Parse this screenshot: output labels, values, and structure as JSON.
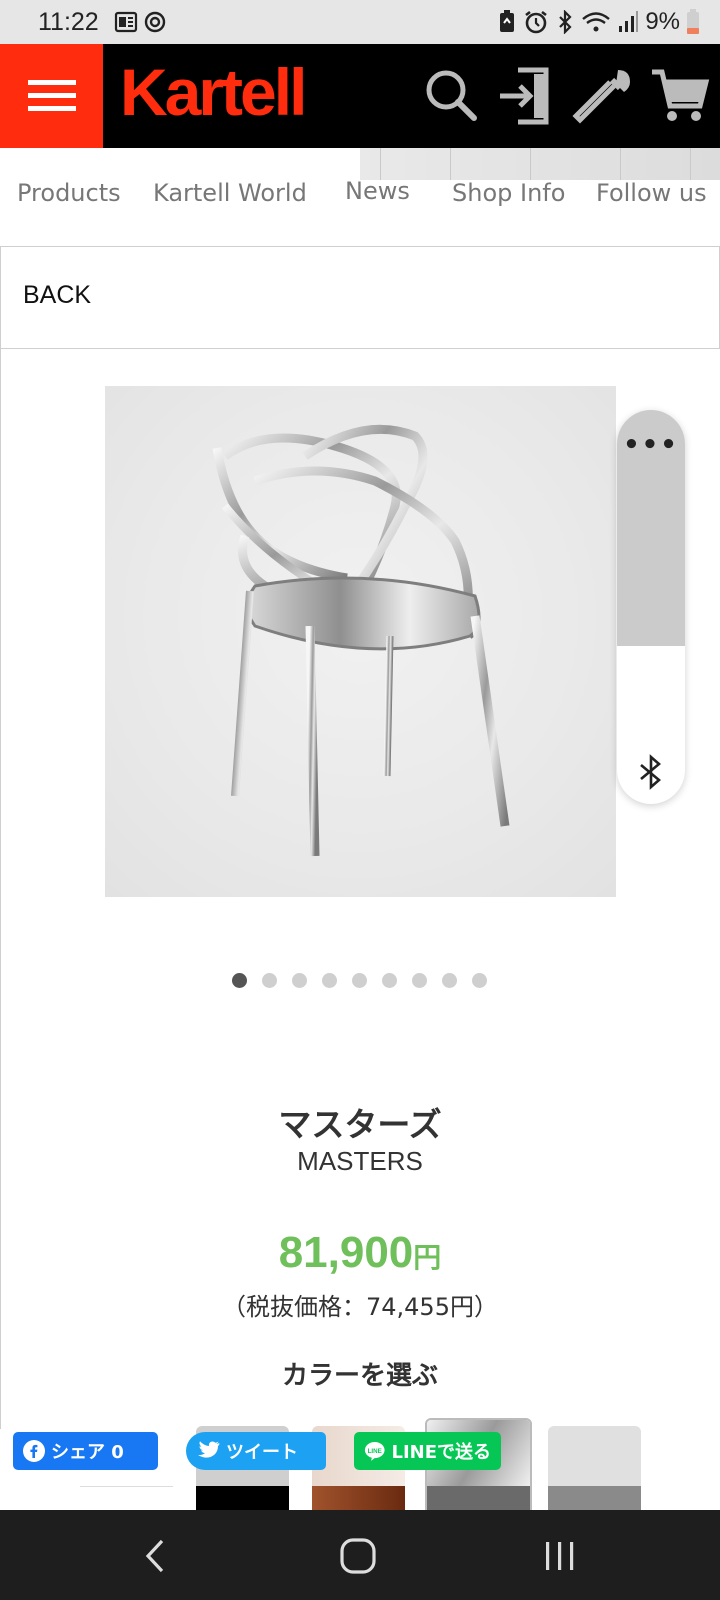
{
  "status_bar": {
    "time": "11:22",
    "battery": "9%",
    "icons": [
      "news-icon",
      "sync-icon",
      "battery-saver-icon",
      "alarm-icon",
      "bluetooth-icon",
      "wifi-icon",
      "signal-icon",
      "battery-icon"
    ]
  },
  "header": {
    "brand": "Kartell",
    "brand_color": "#ff2d0e",
    "icons": [
      "menu-icon",
      "search-icon",
      "login-icon",
      "eyedropper-icon",
      "cart-icon"
    ]
  },
  "nav": {
    "items": [
      "Products",
      "Kartell World",
      "News",
      "Shop Info",
      "Follow us"
    ]
  },
  "back_label": "BACK",
  "carousel": {
    "count": 9,
    "active_index": 0
  },
  "product": {
    "name_jp": "マスターズ",
    "name_en": "MASTERS",
    "price": "81,900",
    "price_unit": "円",
    "price_tax": "（税抜価格：74,455円）",
    "price_color": "#6fbf5b",
    "color_select_title": "カラーを選ぶ"
  },
  "swatches": [
    {
      "top": "#ffffff",
      "bottom": "#ffffff"
    },
    {
      "top": "#cfcfcf",
      "bottom": "#000000"
    },
    {
      "top": "#e8d7cc",
      "bottom": "#8a3a1a"
    },
    {
      "top": "#dcdcdc",
      "bottom": "#6a6a6a",
      "selected": true
    },
    {
      "top": "#e0e0e0",
      "bottom": "#8a8a8a"
    }
  ],
  "share": {
    "facebook": "シェア 0",
    "twitter": "ツイート",
    "line": "LINEで送る"
  },
  "side_widget": {
    "menu": "•••",
    "icon": "bluetooth-icon"
  }
}
